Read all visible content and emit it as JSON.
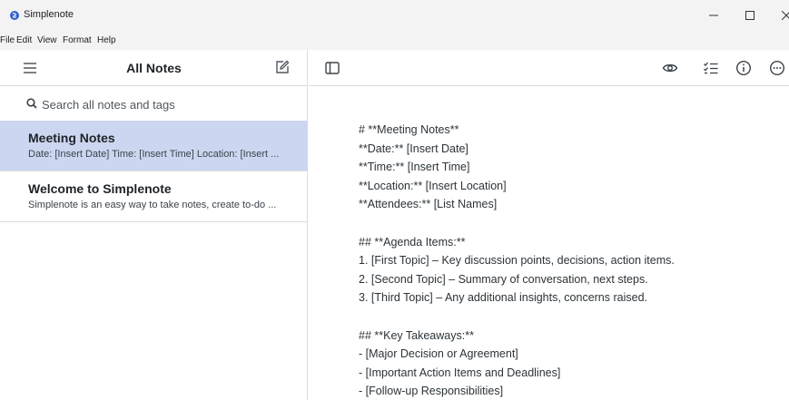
{
  "window": {
    "title": "Simplenote",
    "accent_color": "#3361cc"
  },
  "menu": {
    "items": [
      "File",
      "Edit",
      "View",
      "Format",
      "Help"
    ]
  },
  "sidebar": {
    "title": "All Notes",
    "search_placeholder": "Search all notes and tags",
    "notes": [
      {
        "title": "Meeting Notes",
        "preview": "Date: [Insert Date] Time: [Insert Time] Location: [Insert ...",
        "selected": true
      },
      {
        "title": "Welcome to Simplenote",
        "preview": "Simplenote is an easy way to take notes, create to-do ...",
        "selected": false
      }
    ],
    "selected_color": "#ccd6f0"
  },
  "editor": {
    "lines": [
      "# **Meeting Notes**",
      "**Date:** [Insert Date]",
      "**Time:** [Insert Time]",
      "**Location:** [Insert Location]",
      "**Attendees:** [List Names]",
      "",
      "## **Agenda Items:**",
      "1. [First Topic] – Key discussion points, decisions, action items.",
      "2. [Second Topic] – Summary of conversation, next steps.",
      "3. [Third Topic] – Any additional insights, concerns raised.",
      "",
      "## **Key Takeaways:**",
      "- [Major Decision or Agreement]",
      "- [Important Action Items and Deadlines]",
      "- [Follow-up Responsibilities]"
    ]
  },
  "icons": {
    "app": "simplenote-logo-icon",
    "menu": "hamburger-icon",
    "new_note": "new-note-icon",
    "search": "search-icon",
    "toggle_sidebar": "sidebar-toggle-icon",
    "preview": "eye-icon",
    "checklist": "checklist-icon",
    "info": "info-icon",
    "more": "more-icon"
  }
}
